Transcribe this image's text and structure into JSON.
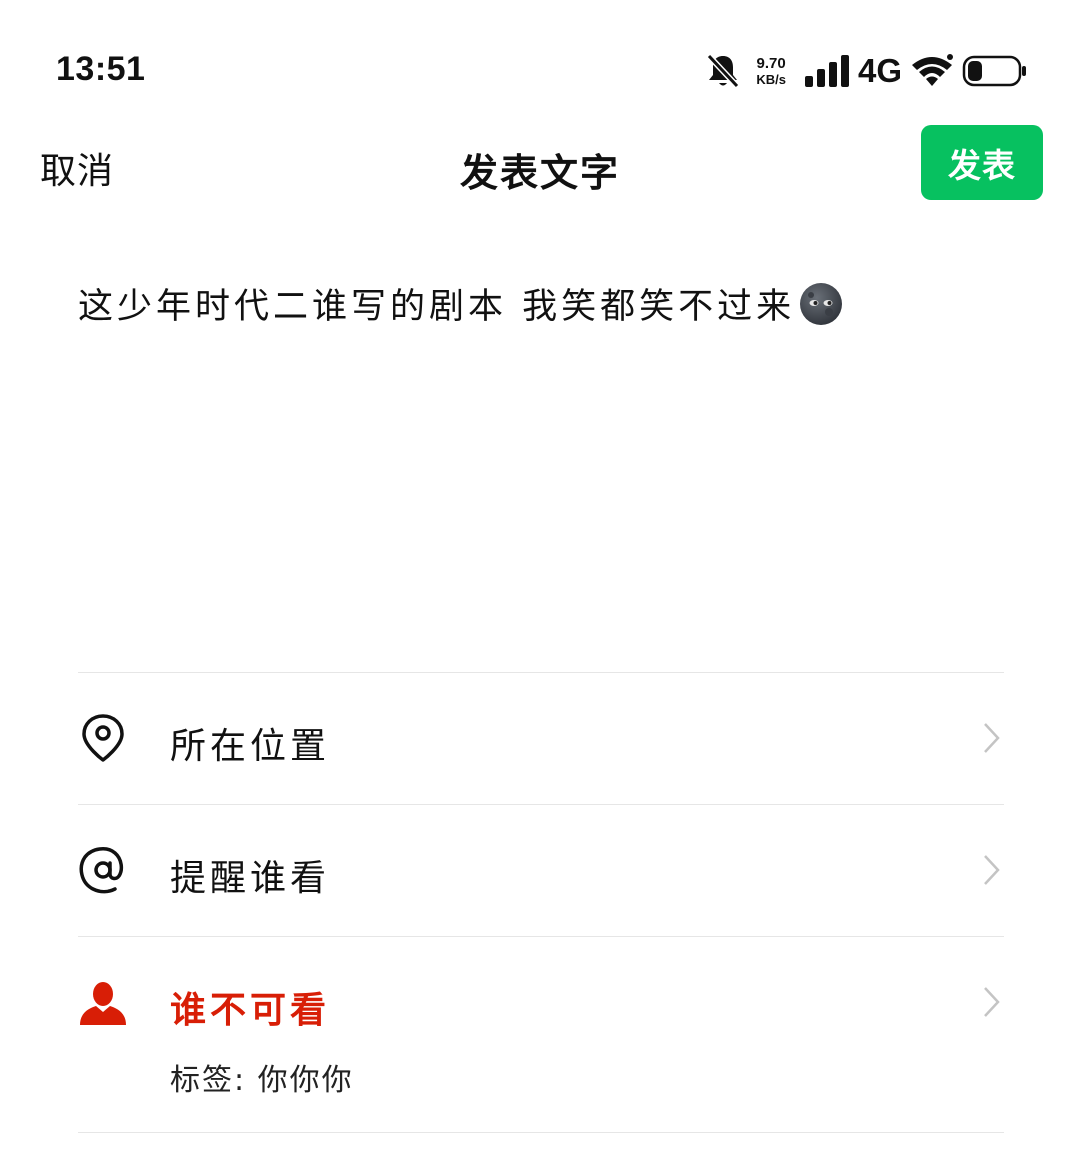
{
  "status_bar": {
    "time": "13:51",
    "net_speed_value": "9.70",
    "net_speed_unit": "KB/s",
    "network_type": "4G",
    "icons": [
      "bell-muted-icon",
      "signal-icon",
      "wifi-icon",
      "battery-icon"
    ]
  },
  "header": {
    "cancel_label": "取消",
    "title": "发表文字",
    "publish_label": "发表"
  },
  "compose": {
    "text": "这少年时代二谁写的剧本  我笑都笑不过来",
    "emoji": "new-moon-face-icon"
  },
  "options": {
    "location": {
      "label": "所在位置",
      "icon": "location-pin-icon"
    },
    "mention": {
      "label": "提醒谁看",
      "icon": "at-icon"
    },
    "visibility": {
      "label": "谁不可看",
      "icon": "user-icon",
      "tag_line": "标签: 你你你"
    }
  },
  "colors": {
    "accent_green": "#07c160",
    "warning_red": "#d81e06",
    "divider": "#e6e6e6"
  }
}
